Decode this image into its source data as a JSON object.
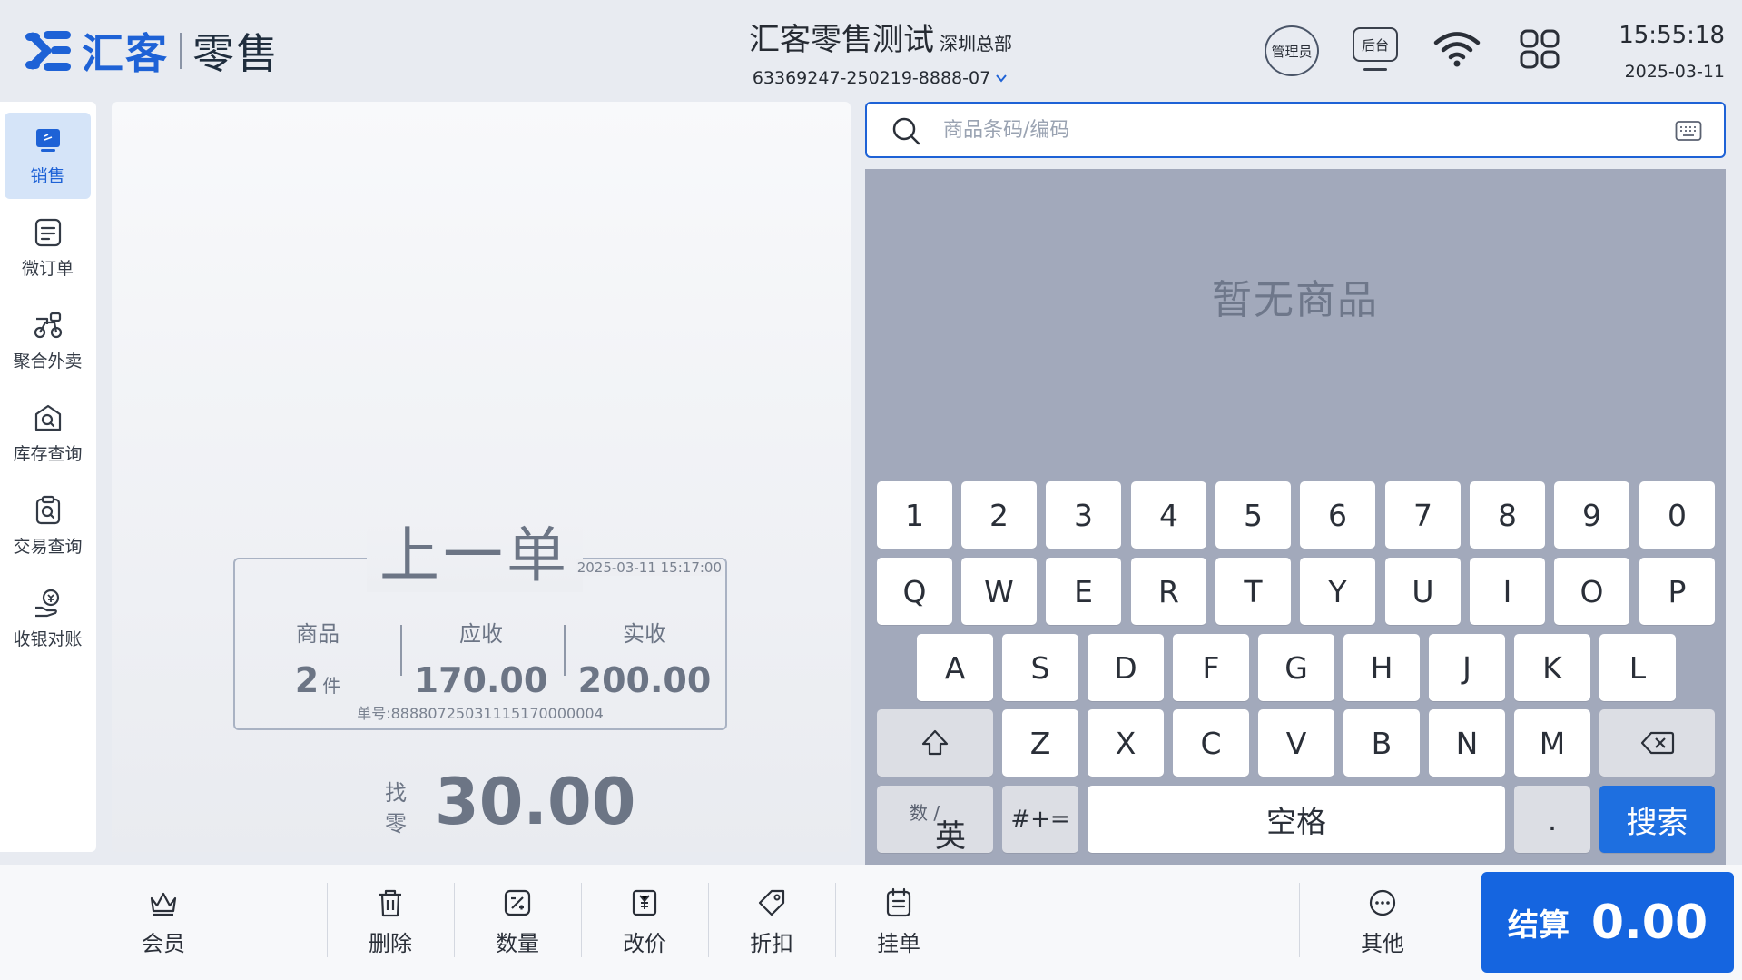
{
  "brand": {
    "name": "汇客",
    "product": "零售"
  },
  "store": {
    "name": "汇客零售测试",
    "branch": "深圳总部",
    "code": "63369247-250219-8888-07"
  },
  "header": {
    "user_badge": "管理员",
    "backend_label": "后台",
    "time": "15:55:18",
    "date": "2025-03-11"
  },
  "sidebar": {
    "items": [
      {
        "label": "销售",
        "icon": "sales-icon",
        "active": true
      },
      {
        "label": "微订单",
        "icon": "micro-order-icon"
      },
      {
        "label": "聚合外卖",
        "icon": "delivery-icon"
      },
      {
        "label": "库存查询",
        "icon": "inventory-search-icon"
      },
      {
        "label": "交易查询",
        "icon": "transaction-search-icon"
      },
      {
        "label": "收银对账",
        "icon": "reconcile-icon"
      }
    ]
  },
  "last_order": {
    "title": "上一单",
    "datetime": "2025-03-11 15:17:00",
    "items_label": "商品",
    "items_value": "2",
    "items_unit": "件",
    "due_label": "应收",
    "due_value": "170.00",
    "received_label": "实收",
    "received_value": "200.00",
    "order_no": "单号:888807250311151700000​04",
    "change_label_1": "找",
    "change_label_2": "零",
    "change_value": "30.00"
  },
  "search": {
    "placeholder": "商品条码/编码"
  },
  "products": {
    "empty_text": "暂无商品"
  },
  "keyboard": {
    "row1": [
      "1",
      "2",
      "3",
      "4",
      "5",
      "6",
      "7",
      "8",
      "9",
      "0"
    ],
    "row2": [
      "Q",
      "W",
      "E",
      "R",
      "T",
      "Y",
      "U",
      "I",
      "O",
      "P"
    ],
    "row3": [
      "A",
      "S",
      "D",
      "F",
      "G",
      "H",
      "J",
      "K",
      "L"
    ],
    "row4": [
      "Z",
      "X",
      "C",
      "V",
      "B",
      "N",
      "M"
    ],
    "mode_small": "数 /",
    "mode_big": "英",
    "symbols": "#+=",
    "space": "空格",
    "dot": ".",
    "search": "搜索"
  },
  "toolbar": {
    "member": "会员",
    "delete": "删除",
    "quantity": "数量",
    "reprice": "改价",
    "discount": "折扣",
    "hold": "挂单",
    "other": "其他",
    "checkout_label": "结算",
    "checkout_value": "0.00"
  },
  "colors": {
    "accent": "#1e62d6",
    "primary_button": "#1565e0",
    "product_area": "#a2a9bb"
  }
}
